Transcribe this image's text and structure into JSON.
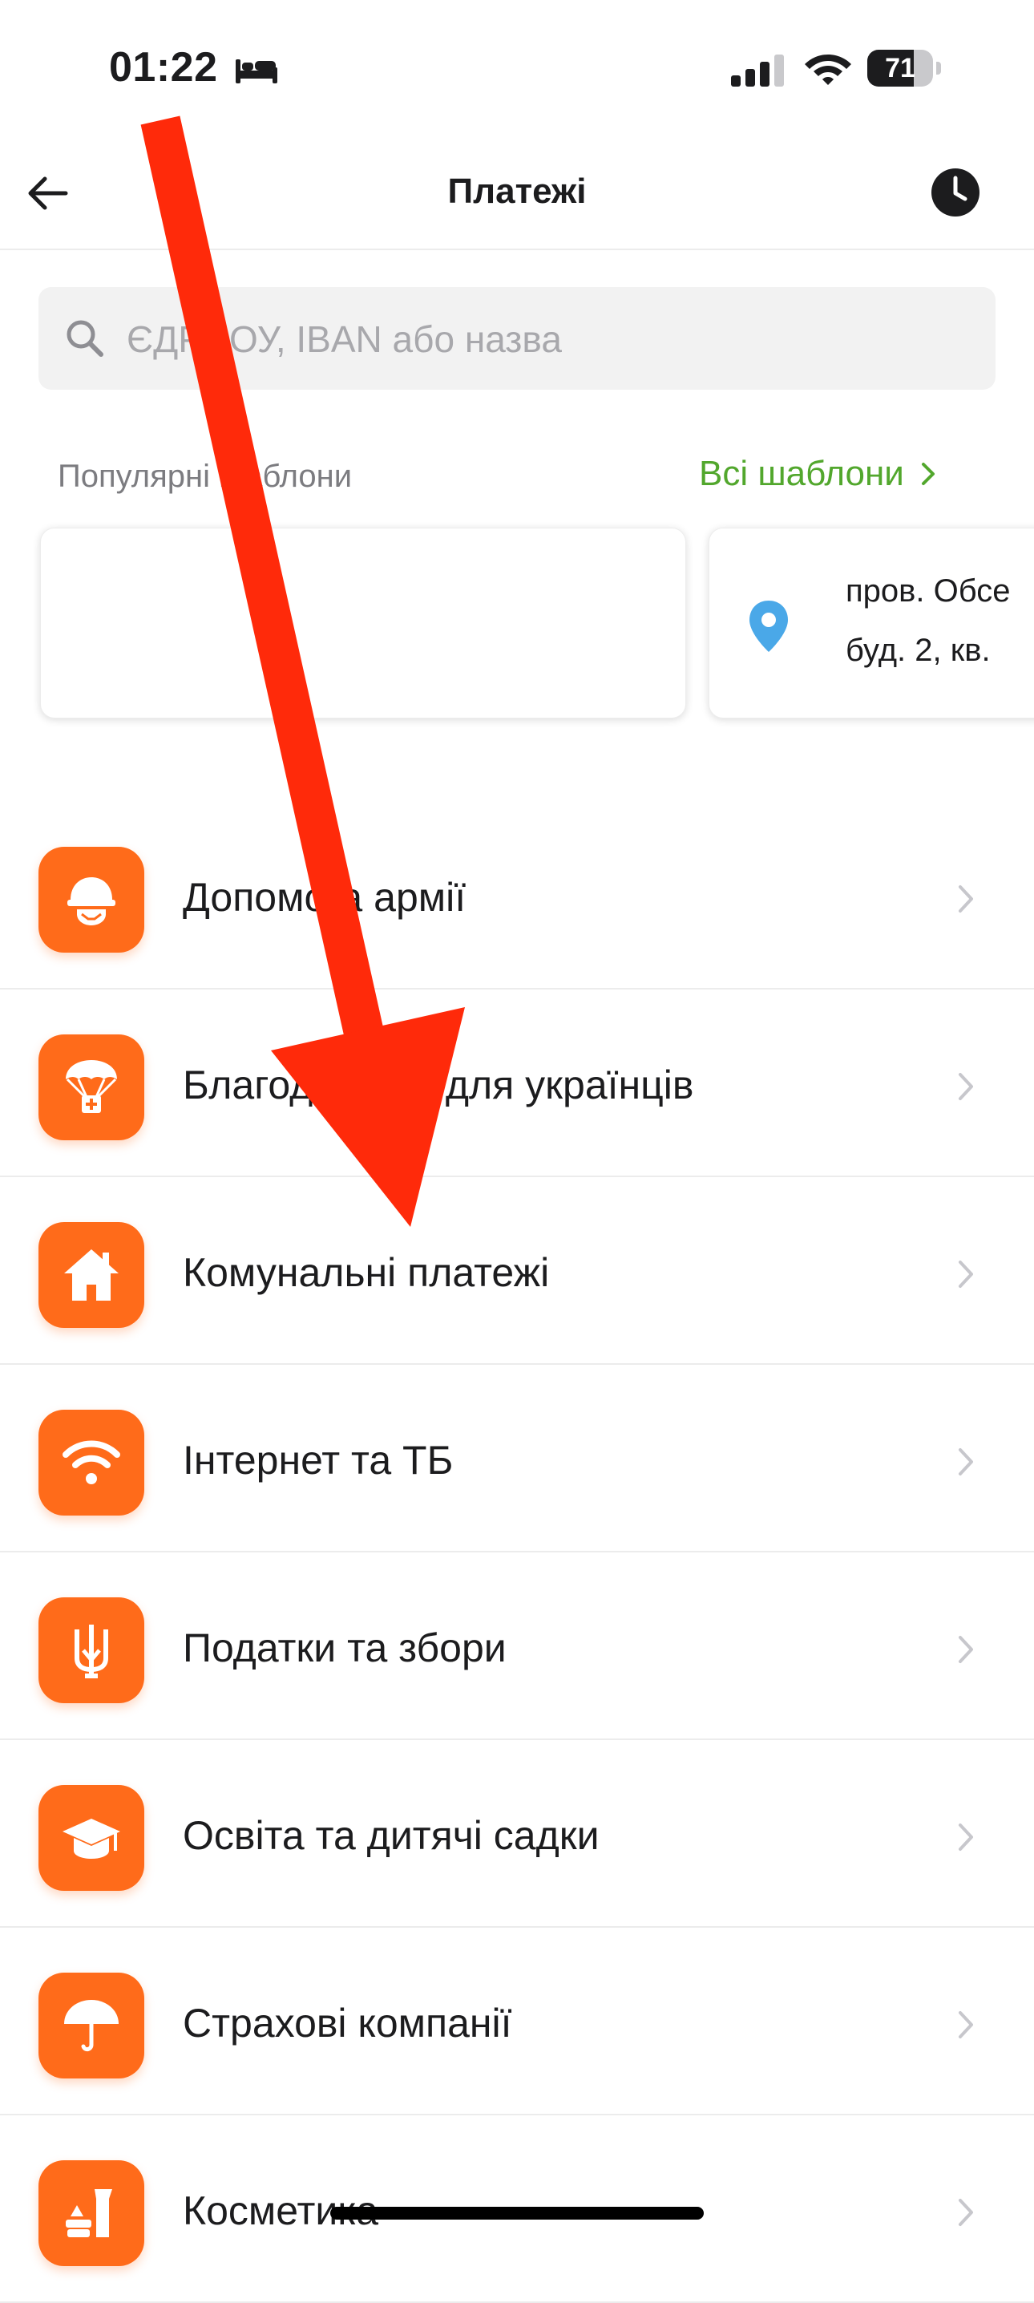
{
  "status_bar": {
    "time": "01:22",
    "sleep_icon": "bed-icon",
    "signal_icon": "cellular-signal-icon",
    "wifi_icon": "wifi-icon",
    "battery_percent": "71",
    "battery_level": 0.71
  },
  "nav": {
    "title": "Платежі",
    "back_icon": "arrow-left-icon",
    "history_icon": "clock-icon"
  },
  "search": {
    "placeholder": "ЄДРПОУ, IBAN або назва"
  },
  "templates": {
    "title": "Популярні шаблони",
    "all_link": "Всі шаблони",
    "cards": [
      {
        "lines": []
      },
      {
        "icon": "location-pin-icon",
        "lines": [
          "пров. Обсе",
          "буд. 2, кв."
        ]
      }
    ]
  },
  "categories": [
    {
      "label": "Допомога армії",
      "icon": "soldier-helmet-icon"
    },
    {
      "label": "Благодійність для українців",
      "icon": "parachute-aid-icon"
    },
    {
      "label": "Комунальні платежі",
      "icon": "house-icon"
    },
    {
      "label": "Інтернет та ТБ",
      "icon": "wifi-icon"
    },
    {
      "label": "Податки та збори",
      "icon": "trident-icon"
    },
    {
      "label": "Освіта та дитячі садки",
      "icon": "graduation-cap-icon"
    },
    {
      "label": "Страхові компанії",
      "icon": "umbrella-icon"
    },
    {
      "label": "Косметика",
      "icon": "cosmetics-icon"
    }
  ],
  "colors": {
    "accent_orange": "#ff6b1a",
    "link_green": "#52a72d",
    "annotation_red": "#ff2a0a",
    "pin_blue": "#4aa8e8"
  }
}
